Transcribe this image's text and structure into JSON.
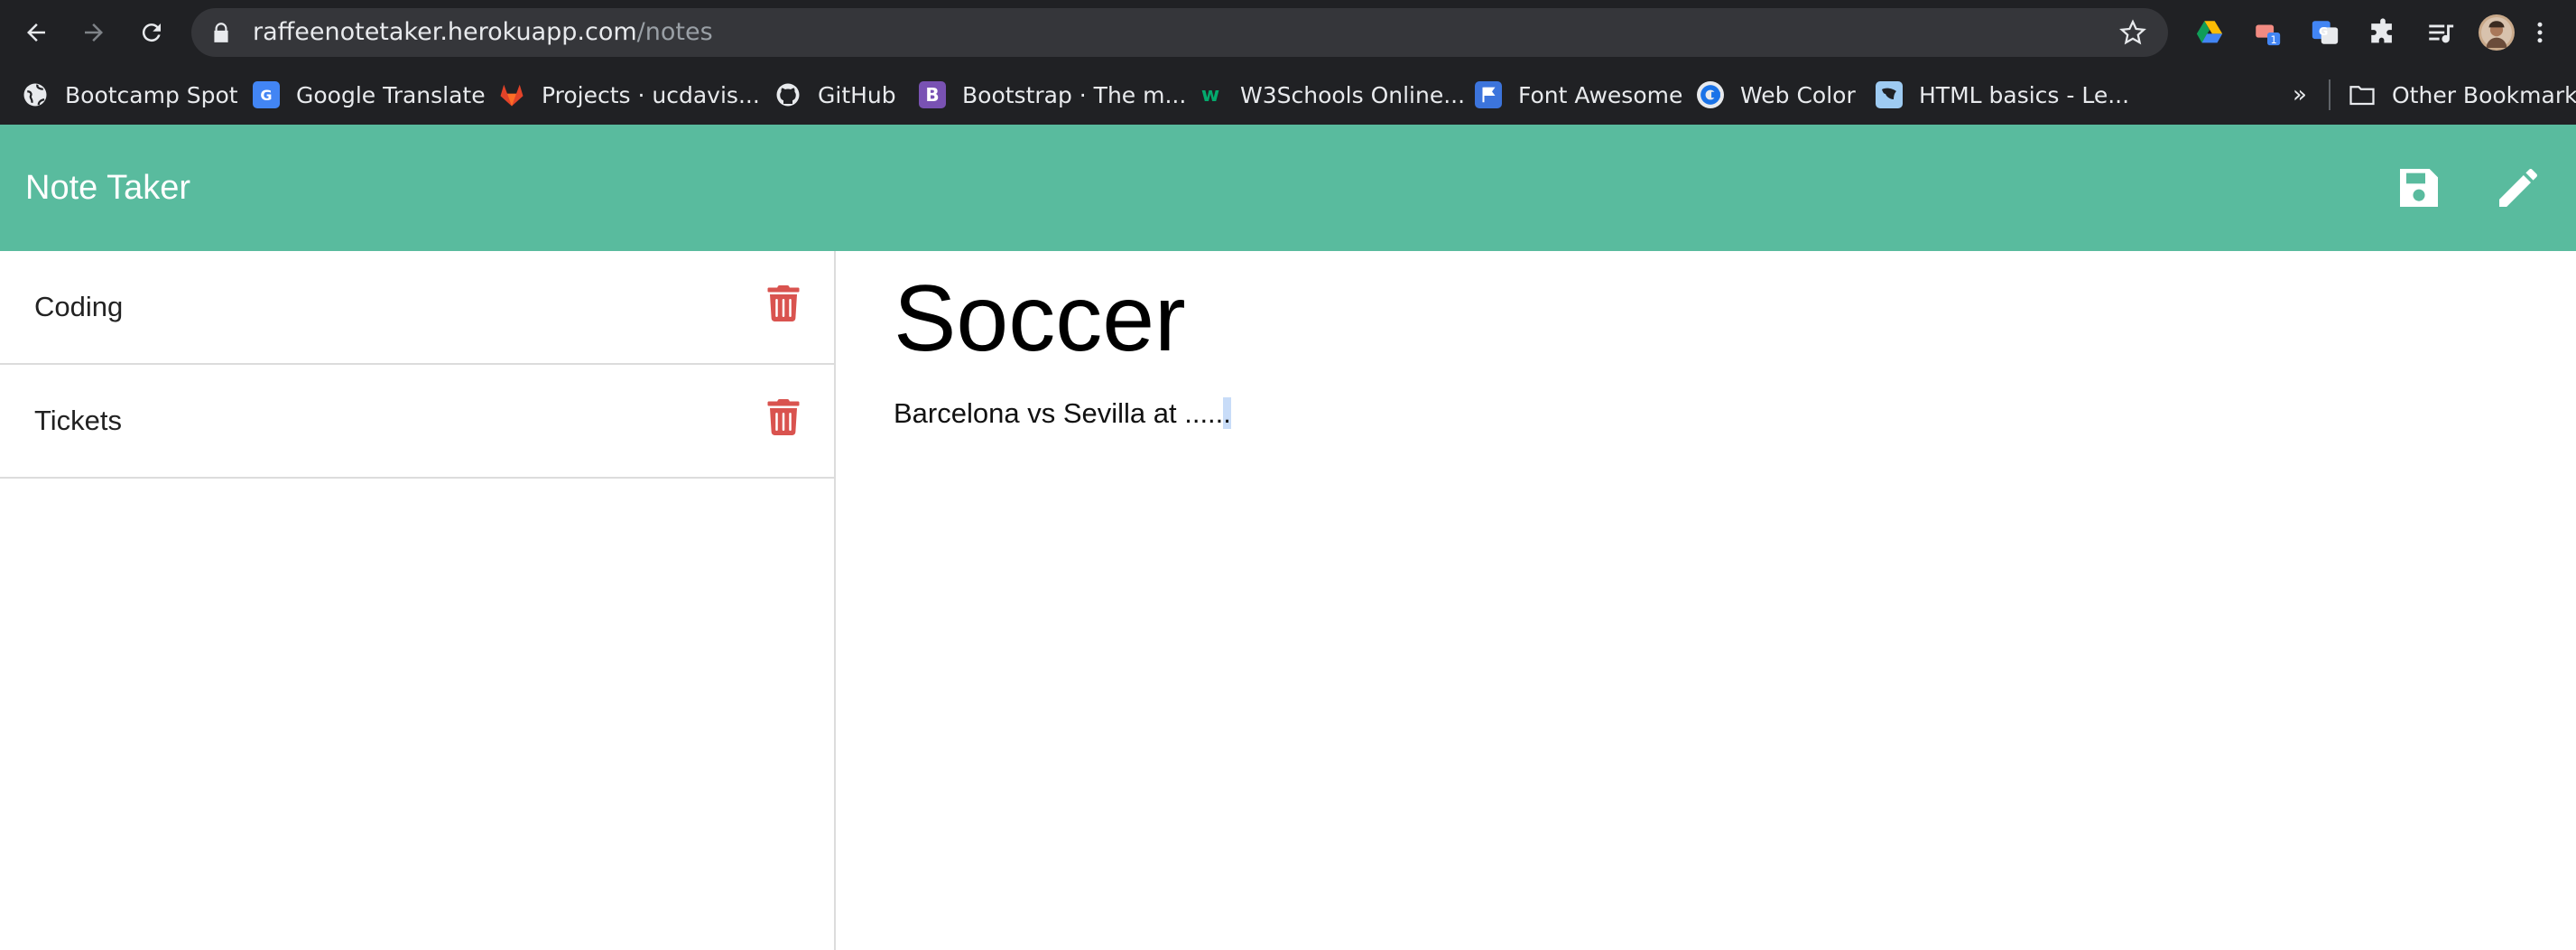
{
  "browser": {
    "url_host": "raffeenotetaker.herokuapp.com",
    "url_path": "/notes",
    "bookmarks": [
      {
        "label": "Bootcamp Spot",
        "icon": "globe-icon"
      },
      {
        "label": "Google Translate",
        "icon": "google-translate-icon"
      },
      {
        "label": "Projects · ucdavis...",
        "icon": "gitlab-icon"
      },
      {
        "label": "GitHub",
        "icon": "github-icon"
      },
      {
        "label": "Bootstrap · The m...",
        "icon": "bootstrap-icon"
      },
      {
        "label": "W3Schools Online...",
        "icon": "w3schools-icon"
      },
      {
        "label": "Font Awesome",
        "icon": "flag-icon"
      },
      {
        "label": "Web Color",
        "icon": "webcolor-icon"
      },
      {
        "label": "HTML basics - Le...",
        "icon": "mdn-icon"
      }
    ],
    "overflow_label": "»",
    "other_bookmarks_label": "Other Bookmarks",
    "extension_badge": "1"
  },
  "app": {
    "brand": "Note Taker",
    "accent_color": "#59bb9e",
    "delete_color": "#d9534f",
    "notes": [
      {
        "title": "Coding"
      },
      {
        "title": "Tickets"
      }
    ],
    "active_note": {
      "title": "Soccer",
      "text_main": "Barcelona vs Sevilla at .....",
      "text_selected": "."
    }
  }
}
